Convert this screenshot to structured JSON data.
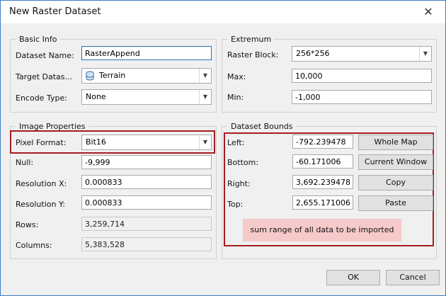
{
  "window": {
    "title": "New Raster Dataset",
    "close_glyph": "✕"
  },
  "basic_info": {
    "legend": "Basic Info",
    "dataset_name_label": "Dataset Name:",
    "dataset_name_value": "RasterAppend",
    "target_datasource_label": "Target Datas...",
    "target_datasource_value": "Terrain",
    "target_datasource_icon": "database-icon",
    "encode_type_label": "Encode Type:",
    "encode_type_value": "None"
  },
  "extremum": {
    "legend": "Extremum",
    "raster_block_label": "Raster Block:",
    "raster_block_value": "256*256",
    "max_label": "Max:",
    "max_value": "10,000",
    "min_label": "Min:",
    "min_value": "-1,000"
  },
  "image_properties": {
    "legend": "Image Properties",
    "pixel_format_label": "Pixel Format:",
    "pixel_format_value": "Bit16",
    "null_label": "Null:",
    "null_value": "-9,999",
    "resolution_x_label": "Resolution X:",
    "resolution_x_value": "0.000833",
    "resolution_y_label": "Resolution Y:",
    "resolution_y_value": "0.000833",
    "rows_label": "Rows:",
    "rows_value": "3,259,714",
    "columns_label": "Columns:",
    "columns_value": "5,383,528"
  },
  "dataset_bounds": {
    "legend": "Dataset Bounds",
    "left_label": "Left:",
    "left_value": "-792.239478",
    "bottom_label": "Bottom:",
    "bottom_value": "-60.171006",
    "right_label": "Right:",
    "right_value": "3,692.239478",
    "top_label": "Top:",
    "top_value": "2,655.171006",
    "whole_map_button": "Whole Map",
    "current_window_button": "Current Window",
    "copy_button": "Copy",
    "paste_button": "Paste",
    "annotation_note": "sum range of all data to be imported"
  },
  "footer": {
    "ok_button": "OK",
    "cancel_button": "Cancel"
  },
  "colors": {
    "highlight_border": "#a51d22",
    "note_background": "#f6caca",
    "focus_border": "#2a6fb8"
  }
}
